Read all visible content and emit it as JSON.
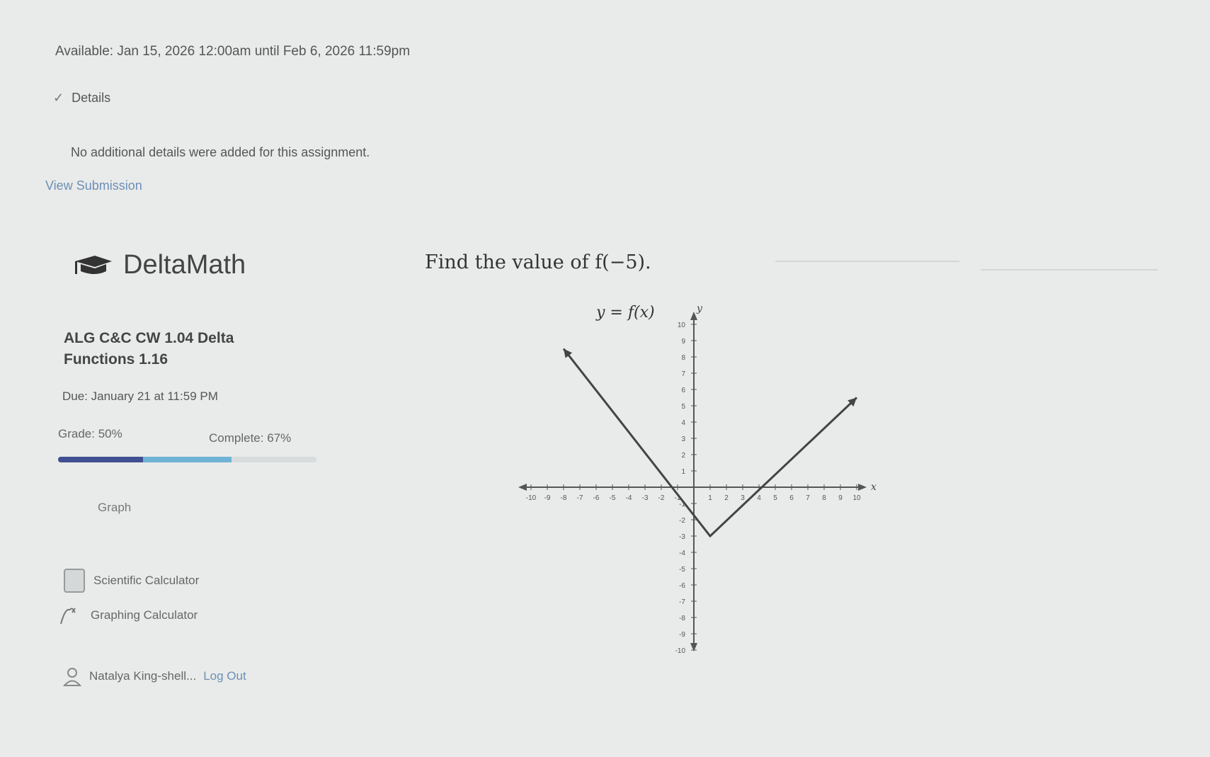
{
  "assignment": {
    "availability": "Available: Jan 15, 2026 12:00am until Feb 6, 2026 11:59pm",
    "details_label": "Details",
    "details_text": "No additional details were added for this assignment.",
    "view_link": "View Submission"
  },
  "deltamath": {
    "logo_text": "DeltaMath",
    "title": "ALG C&C CW 1.04 Delta Functions 1.16",
    "due": "Due: January 21 at 11:59 PM",
    "grade_text": "Grade: 50%",
    "complete_text": "Complete: 67%",
    "grade_fraction": 0.5,
    "complete_fraction": 0.67,
    "graph_link": "Graph",
    "sci_calc": "Scientific Calculator",
    "graph_calc": "Graphing Calculator",
    "user_name": "Natalya King-shell...",
    "logout": "Log Out"
  },
  "question": {
    "text": "Find the value of f(−5)."
  },
  "chart_data": {
    "type": "line",
    "title": "y = f(x)",
    "xlabel": "x",
    "ylabel": "y",
    "xlim": [
      -10,
      10
    ],
    "ylim": [
      -10,
      10
    ],
    "grid": false,
    "xticks": [
      -10,
      -9,
      -8,
      -7,
      -6,
      -5,
      -4,
      -3,
      -2,
      -1,
      1,
      2,
      3,
      4,
      5,
      6,
      7,
      8,
      9,
      10
    ],
    "yticks": [
      -10,
      -9,
      -8,
      -7,
      -6,
      -5,
      -4,
      -3,
      -2,
      -1,
      1,
      2,
      3,
      4,
      5,
      6,
      7,
      8,
      9,
      10
    ],
    "series": [
      {
        "points": [
          [
            -8,
            8.5
          ],
          [
            1,
            -3
          ],
          [
            10,
            5.5
          ]
        ]
      }
    ]
  },
  "colors": {
    "background": "#e9ebea",
    "progress_grade": "#3f4f92",
    "progress_complete": "#6fb3d6",
    "link": "#6c8fb5",
    "curve": "#444444",
    "axis": "#555555"
  }
}
